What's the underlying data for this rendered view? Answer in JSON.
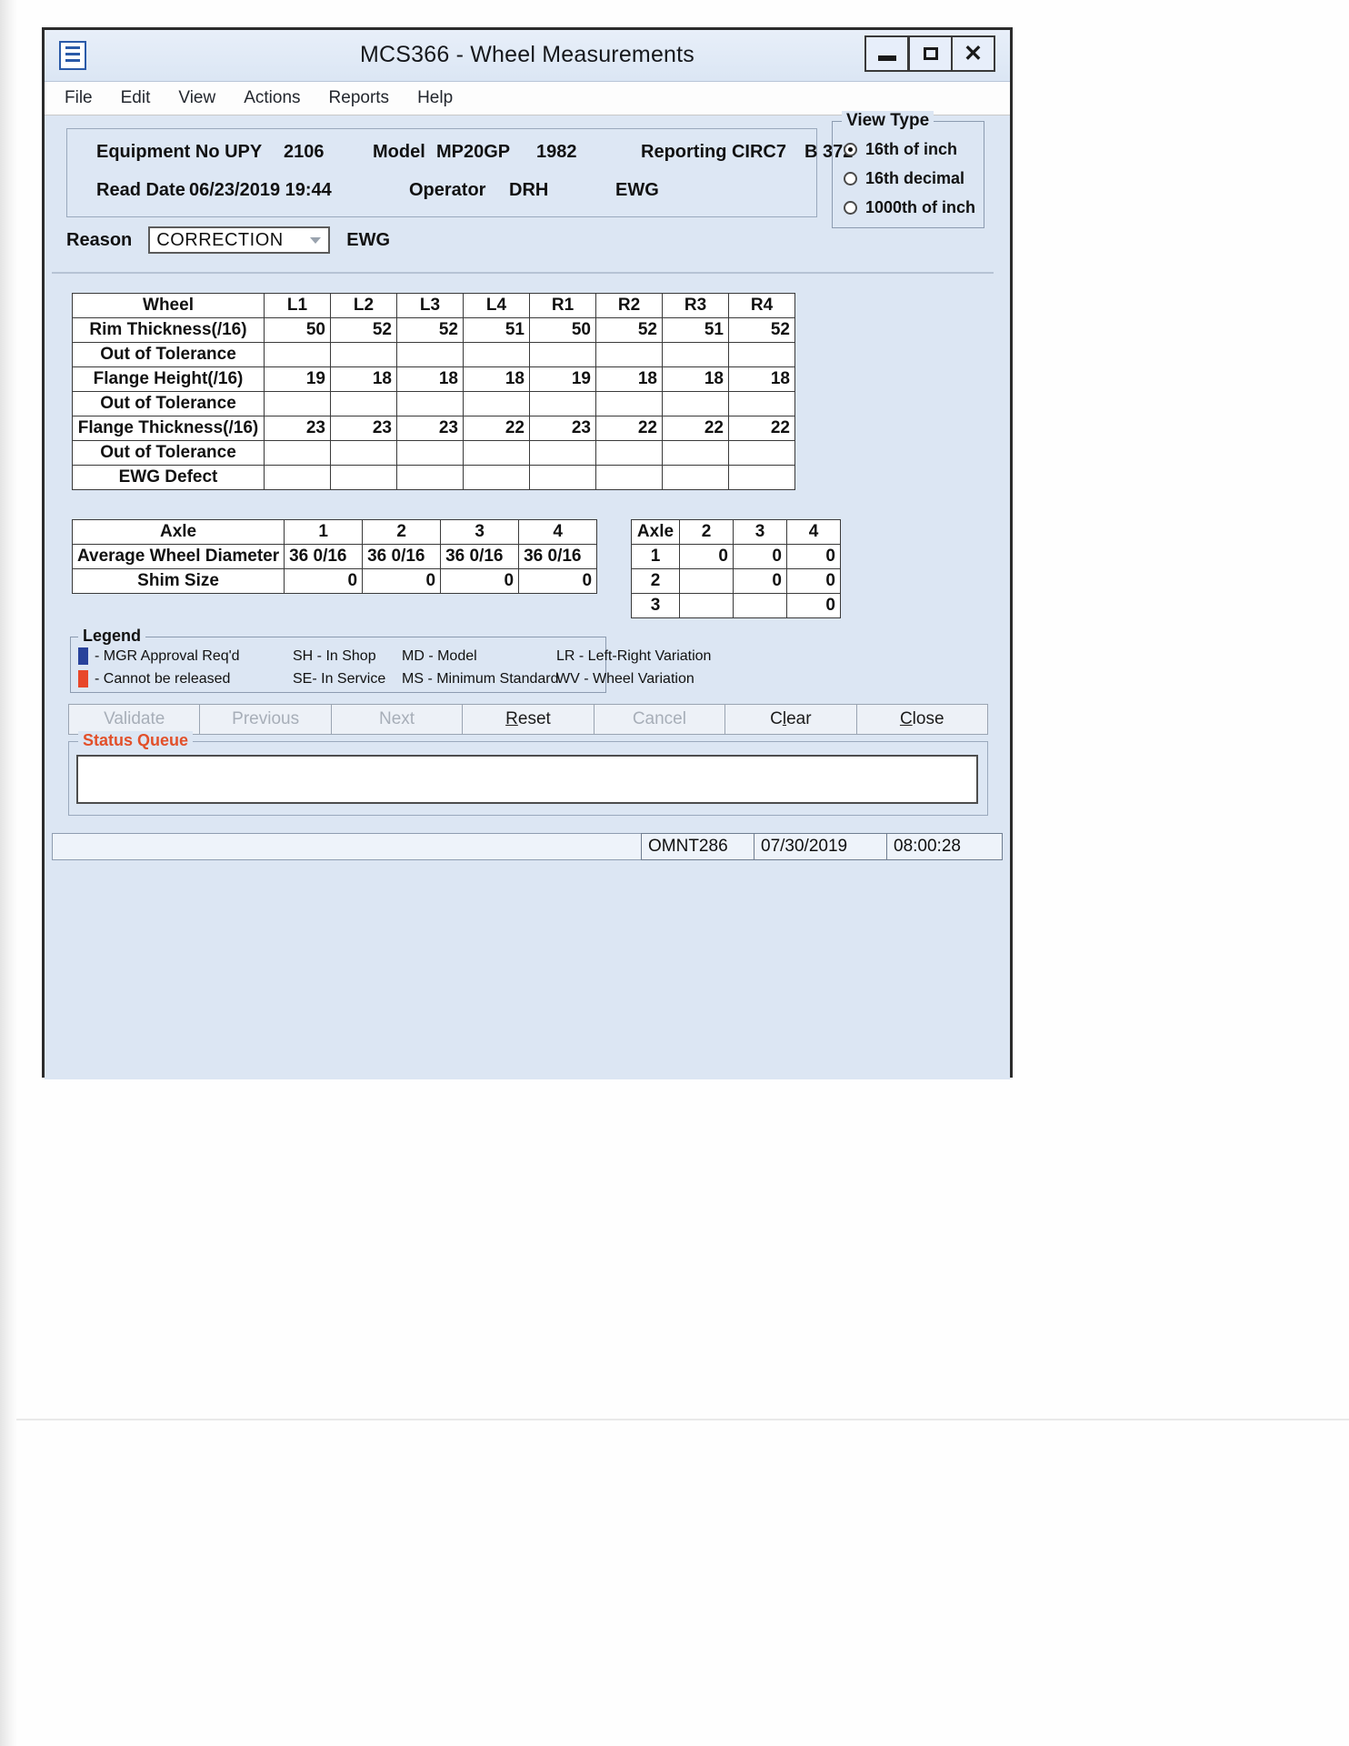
{
  "window": {
    "title": "MCS366 - Wheel Measurements",
    "icon": "document-window-icon",
    "controls": {
      "minimize": "minimize-icon",
      "maximize": "maximize-icon",
      "close": "close-icon"
    }
  },
  "menubar": {
    "items": [
      "File",
      "Edit",
      "View",
      "Actions",
      "Reports",
      "Help"
    ]
  },
  "info": {
    "equipment_label": "Equipment No UPY",
    "equipment_value": "2106",
    "model_label": "Model",
    "model_value": "MP20GP",
    "model_year": "1982",
    "reporting_label": "Reporting CIRC7",
    "reporting_value": "B 372",
    "read_date_label": "Read Date",
    "read_date_value": "06/23/2019 19:44",
    "operator_label": "Operator",
    "operator_value": "DRH",
    "ewg": "EWG"
  },
  "view_type": {
    "title": "View Type",
    "options": [
      {
        "label": "16th of inch",
        "selected": true
      },
      {
        "label": "16th decimal",
        "selected": false
      },
      {
        "label": "1000th of inch",
        "selected": false
      }
    ]
  },
  "reason": {
    "label": "Reason",
    "value": "CORRECTION",
    "trailing": "EWG"
  },
  "wheel_table": {
    "header": [
      "Wheel",
      "L1",
      "L2",
      "L3",
      "L4",
      "R1",
      "R2",
      "R3",
      "R4"
    ],
    "rows": [
      {
        "label": "Rim Thickness(/16)",
        "values": [
          "50",
          "52",
          "52",
          "51",
          "50",
          "52",
          "51",
          "52"
        ]
      },
      {
        "label": "Out of Tolerance",
        "values": [
          "",
          "",
          "",
          "",
          "",
          "",
          "",
          ""
        ]
      },
      {
        "label": "Flange Height(/16)",
        "values": [
          "19",
          "18",
          "18",
          "18",
          "19",
          "18",
          "18",
          "18"
        ]
      },
      {
        "label": "Out of Tolerance",
        "values": [
          "",
          "",
          "",
          "",
          "",
          "",
          "",
          ""
        ]
      },
      {
        "label": "Flange Thickness(/16)",
        "values": [
          "23",
          "23",
          "23",
          "22",
          "23",
          "22",
          "22",
          "22"
        ]
      },
      {
        "label": "Out of Tolerance",
        "values": [
          "",
          "",
          "",
          "",
          "",
          "",
          "",
          ""
        ]
      },
      {
        "label": "EWG Defect",
        "values": [
          "",
          "",
          "",
          "",
          "",
          "",
          "",
          ""
        ]
      }
    ]
  },
  "axle_table": {
    "header": [
      "Axle",
      "1",
      "2",
      "3",
      "4"
    ],
    "rows": [
      {
        "label": "Average Wheel Diameter",
        "values": [
          "36  0/16",
          "36  0/16",
          "36  0/16",
          "36  0/16"
        ],
        "align": "left"
      },
      {
        "label": "Shim Size",
        "values": [
          "0",
          "0",
          "0",
          "0"
        ],
        "align": "right"
      }
    ]
  },
  "matrix_table": {
    "header": [
      "Axle",
      "2",
      "3",
      "4"
    ],
    "rows": [
      {
        "label": "1",
        "values": [
          "0",
          "0",
          "0"
        ]
      },
      {
        "label": "2",
        "values": [
          "",
          "0",
          "0"
        ]
      },
      {
        "label": "3",
        "values": [
          "",
          "",
          "0"
        ]
      }
    ]
  },
  "legend": {
    "title": "Legend",
    "swatch_blue": "#28429b",
    "swatch_red": "#e8472a",
    "row1": {
      "swatch_text": "- MGR Approval Req'd",
      "c1": "SH - In Shop",
      "c2": "MD - Model",
      "c3": "LR - Left-Right Variation"
    },
    "row2": {
      "swatch_text": "- Cannot be released",
      "c1": "SE- In Service",
      "c2": "MS - Minimum Standard",
      "c3": "WV - Wheel Variation"
    }
  },
  "buttons": [
    {
      "label": "Validate",
      "disabled": true,
      "mnemonic": ""
    },
    {
      "label": "Previous",
      "disabled": true,
      "mnemonic": ""
    },
    {
      "label": "Next",
      "disabled": true,
      "mnemonic": ""
    },
    {
      "label": "Reset",
      "disabled": false,
      "mnemonic": "R"
    },
    {
      "label": "Cancel",
      "disabled": true,
      "mnemonic": ""
    },
    {
      "label": "Clear",
      "disabled": false,
      "mnemonic": "l"
    },
    {
      "label": "Close",
      "disabled": false,
      "mnemonic": "C"
    }
  ],
  "status_queue": {
    "title": "Status Queue",
    "value": ""
  },
  "status_bar": {
    "user": "OMNT286",
    "date": "07/30/2019",
    "time": "08:00:28"
  }
}
